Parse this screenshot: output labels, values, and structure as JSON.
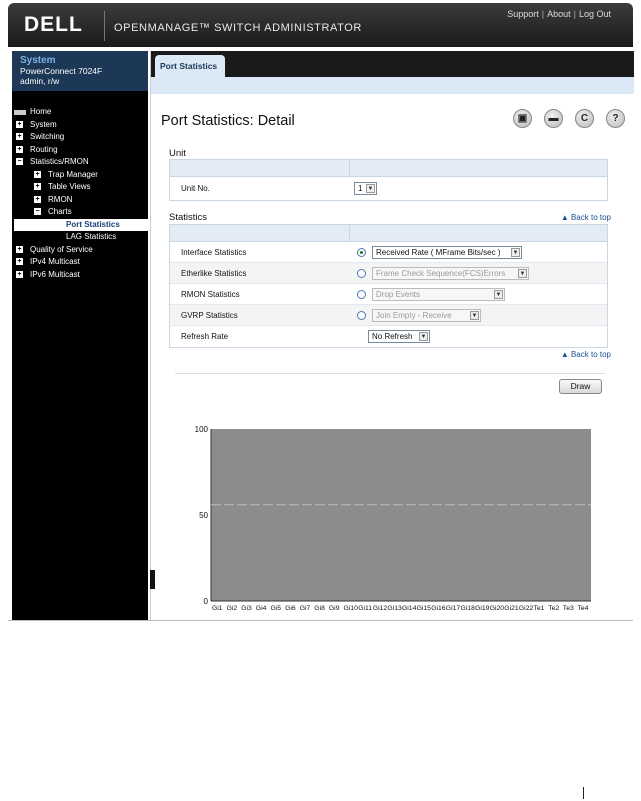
{
  "header": {
    "logo": "DELL",
    "app_title": "OPENMANAGE™ SWITCH ADMINISTRATOR",
    "links": [
      "Support",
      "About",
      "Log Out"
    ]
  },
  "system": {
    "title": "System",
    "model": "PowerConnect 7024F",
    "user": "admin, r/w"
  },
  "nav": {
    "home": "Home",
    "system": "System",
    "switching": "Switching",
    "routing": "Routing",
    "stats_rmon": "Statistics/RMON",
    "trap_manager": "Trap Manager",
    "table_views": "Table Views",
    "rmon": "RMON",
    "charts": "Charts",
    "port_statistics": "Port Statistics",
    "lag_statistics": "LAG Statistics",
    "qos": "Quality of Service",
    "ipv4_multicast": "IPv4 Multicast",
    "ipv6_multicast": "IPv6 Multicast"
  },
  "tab": {
    "label": "Port Statistics"
  },
  "page": {
    "title": "Port Statistics: Detail"
  },
  "toolbar_icons": [
    "save-icon",
    "print-icon",
    "refresh-icon",
    "help-icon"
  ],
  "unit": {
    "section_title": "Unit",
    "label": "Unit No.",
    "value": "1"
  },
  "statistics": {
    "section_title": "Statistics",
    "back_to_top": "Back to top",
    "rows": [
      {
        "label": "Interface Statistics",
        "selected": true,
        "value": "Received Rate ( MFrame Bits/sec )"
      },
      {
        "label": "Etherlike Statistics",
        "selected": false,
        "value": "Frame Check Sequence(FCS)Errors"
      },
      {
        "label": "RMON Statistics",
        "selected": false,
        "value": "Drop Events"
      },
      {
        "label": "GVRP Statistics",
        "selected": false,
        "value": "Join Empty - Receive"
      }
    ],
    "refresh_label": "Refresh Rate",
    "refresh_value": "No Refresh"
  },
  "back_to_top_2": "Back to top",
  "draw_button": "Draw",
  "chart_data": {
    "type": "bar",
    "categories": [
      "Gi1",
      "Gi2",
      "Gi3",
      "Gi4",
      "Gi5",
      "Gi6",
      "Gi7",
      "Gi8",
      "Gi9",
      "Gi10",
      "Gi11",
      "Gi12",
      "Gi13",
      "Gi14",
      "Gi15",
      "Gi16",
      "Gi17",
      "Gi18",
      "Gi19",
      "Gi20",
      "Gi21",
      "Gi22",
      "Te1",
      "Te2",
      "Te3",
      "Te4"
    ],
    "values": [
      0,
      0,
      0,
      0,
      0,
      0,
      0,
      0,
      0,
      0,
      0,
      0,
      0,
      0,
      0,
      0,
      0,
      0,
      0,
      0,
      0,
      0,
      0,
      0,
      0,
      0
    ],
    "ylim": [
      0,
      100
    ],
    "yticks": [
      0,
      50,
      100
    ],
    "title": "",
    "xlabel": "",
    "ylabel": "",
    "background_color": "#8c8c8c"
  }
}
